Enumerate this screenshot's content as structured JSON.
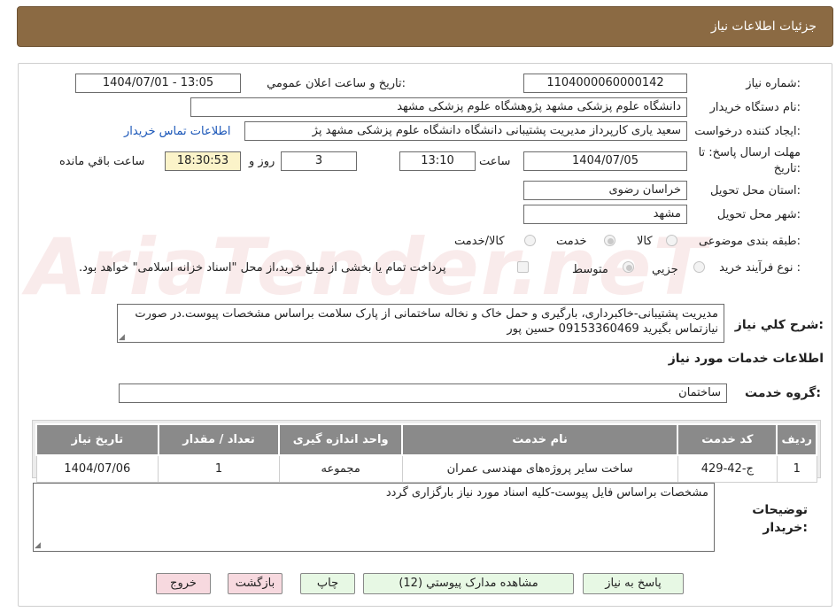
{
  "title": "جزئيات اطلاعات نياز",
  "watermark": "AriaTender.neT",
  "fields": {
    "need_number_label": "شماره نياز:",
    "need_number": "1104000060000142",
    "announce_label": "تاريخ و ساعت اعلان عمومي:",
    "announce_value": "1404/07/01 - 13:05",
    "buyer_org_label": "نام دستگاه خريدار:",
    "buyer_org": "دانشگاه علوم پزشکی مشهد   پژوهشگاه علوم پزشکی مشهد",
    "requester_label": "ايجاد کننده درخواست:",
    "requester": "سعید یاری کارپرداز مدیریت پشتیبانی دانشگاه دانشگاه علوم پزشکی مشهد   پژ",
    "contact_link": "اطلاعات تماس خريدار",
    "deadline_label": "مهلت ارسال پاسخ: تا تاريخ:",
    "deadline_date": "1404/07/05",
    "time_label": "ساعت",
    "deadline_time": "13:10",
    "days": "3",
    "days_label": "روز و",
    "remaining": "18:30:53",
    "remaining_label": "ساعت باقي مانده",
    "province_label": "استان محل تحويل:",
    "province": "خراسان رضوی",
    "city_label": "شهر محل تحويل:",
    "city": "مشهد",
    "category_label": "طبقه بندی موضوعی:",
    "category_options": [
      "کالا",
      "خدمت",
      "کالا/خدمت"
    ],
    "category_selected": "خدمت",
    "process_label": "نوع فرآيند خريد :",
    "process_options": [
      "جزيي",
      "متوسط"
    ],
    "process_selected": "متوسط",
    "payment_note": "پرداخت تمام يا بخشی از مبلغ خريد،از محل \"اسناد خزانه اسلامی\" خواهد بود.",
    "summary_label": "شرح کلي نياز:",
    "summary": "مدیریت پشتیبانی-خاکبرداری، بارگیری و حمل خاک و نخاله ساختمانی از پارک سلامت  براساس مشخصات پیوست.در صورت نیازتماس بگیرید  09153360469  حسین پور",
    "services_heading": "اطلاعات خدمات مورد نياز",
    "service_group_label": "گروه خدمت:",
    "service_group": "ساختمان",
    "buyer_notes_label": "توضيحات خريدار:",
    "buyer_notes": "مشخصات براساس فایل پیوست-کلیه اسناد مورد نیاز بارگزاری گردد"
  },
  "table": {
    "headers": [
      "رديف",
      "کد خدمت",
      "نام خدمت",
      "واحد اندازه گيری",
      "تعداد / مقدار",
      "تاريخ نياز"
    ],
    "rows": [
      [
        "1",
        "ج-42-429",
        "ساخت سایر پروژه‌های مهندسی عمران",
        "مجموعه",
        "1",
        "1404/07/06"
      ]
    ]
  },
  "buttons": {
    "reply": "پاسخ به نياز",
    "attachments": "مشاهده مدارک پيوستي (12)",
    "print": "چاپ",
    "back": "بازگشت",
    "exit": "خروج"
  }
}
